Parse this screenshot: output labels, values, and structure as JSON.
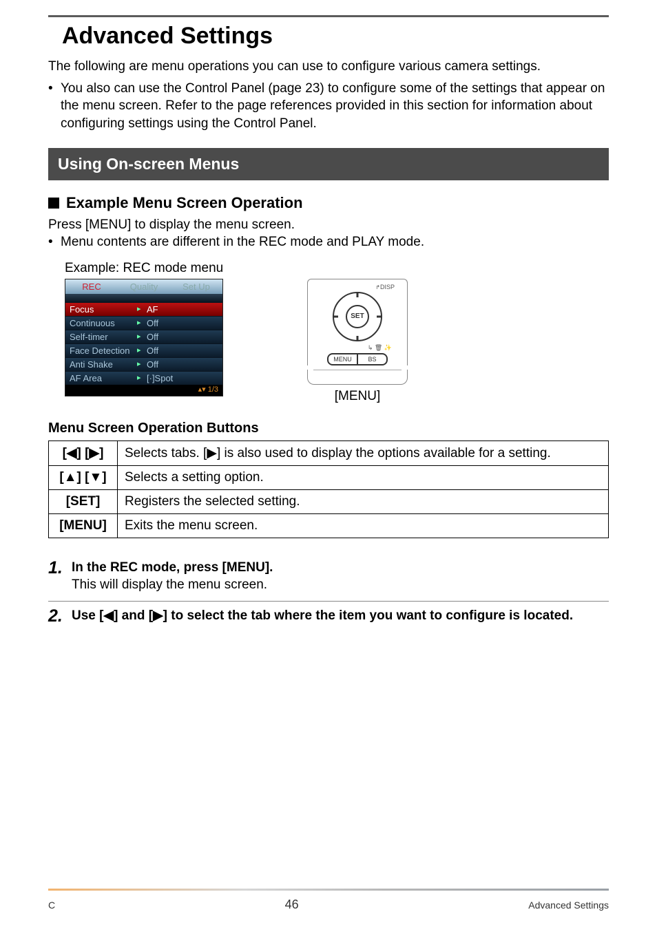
{
  "title": "Advanced Settings",
  "intro": "The following are menu operations you can use to configure various camera settings.",
  "bullet1": "You also can use the Control Panel (page 23) to configure some of the settings that appear on the menu screen. Refer to the page references provided in this section for information about configuring settings using the Control Panel.",
  "section_bar": "Using On-screen Menus",
  "subhead": "Example Menu Screen Operation",
  "press_menu": "Press [MENU] to display the menu screen.",
  "bullet2": "Menu contents are different in the REC mode and PLAY mode.",
  "example_label": "Example: REC mode menu",
  "rec_menu": {
    "tabs": [
      "REC",
      "Quality",
      "Set Up"
    ],
    "items": [
      {
        "k": "Focus",
        "v": "AF",
        "selected": true
      },
      {
        "k": "Continuous",
        "v": "Off"
      },
      {
        "k": "Self-timer",
        "v": "Off"
      },
      {
        "k": "Face Detection",
        "v": "Off"
      },
      {
        "k": "Anti Shake",
        "v": "Off"
      },
      {
        "k": "AF Area",
        "v": "[·]Spot"
      }
    ],
    "page_indicator": "1/3"
  },
  "controller": {
    "disp": "DISP",
    "set": "SET",
    "menu_btn": "MENU",
    "bs_btn": "BS",
    "caption": "[MENU]"
  },
  "buttons_heading": "Menu Screen Operation Buttons",
  "buttons_table": [
    {
      "key": "[◀] [▶]",
      "desc": "Selects tabs. [▶] is also used to display the options available for a setting."
    },
    {
      "key": "[▲] [▼]",
      "desc": "Selects a setting option."
    },
    {
      "key": "[SET]",
      "desc": "Registers the selected setting."
    },
    {
      "key": "[MENU]",
      "desc": "Exits the menu screen."
    }
  ],
  "steps": [
    {
      "num": "1.",
      "title": "In the REC mode, press [MENU].",
      "sub": "This will display the menu screen."
    },
    {
      "num": "2.",
      "title": "Use [◀] and [▶] to select the tab where the item you want to configure is located.",
      "sub": ""
    }
  ],
  "footer": {
    "left": "C",
    "page": "46",
    "right": "Advanced Settings"
  }
}
